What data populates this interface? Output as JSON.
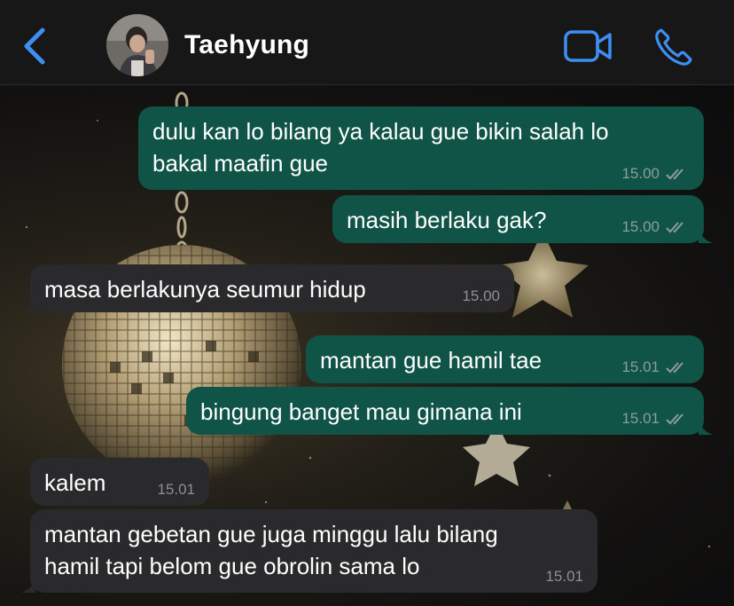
{
  "header": {
    "back_icon": "chevron-left-icon",
    "contact_name": "Taehyung",
    "video_icon": "video-camera-icon",
    "call_icon": "phone-icon",
    "accent_color": "#3d8ff3"
  },
  "colors": {
    "outgoing_bubble": "#0f5447",
    "incoming_bubble": "#2a2a2c",
    "timestamp": "#8c9e9a"
  },
  "messages": [
    {
      "direction": "out",
      "text": "dulu kan lo bilang ya kalau gue bikin salah lo\nbakal maafin gue",
      "time": "15.00",
      "status_icon": "double-check-icon"
    },
    {
      "direction": "out",
      "text": "masih berlaku gak?",
      "time": "15.00",
      "status_icon": "double-check-icon"
    },
    {
      "direction": "in",
      "text": "masa berlakunya seumur hidup",
      "time": "15.00"
    },
    {
      "direction": "out",
      "text": "mantan gue hamil tae",
      "time": "15.01",
      "status_icon": "double-check-icon"
    },
    {
      "direction": "out",
      "text": "bingung banget mau gimana ini",
      "time": "15.01",
      "status_icon": "double-check-icon"
    },
    {
      "direction": "in",
      "text": "kalem",
      "time": "15.01"
    },
    {
      "direction": "in",
      "text": "mantan gebetan gue juga minggu lalu bilang\nhamil tapi belom gue obrolin sama lo",
      "time": "15.01"
    }
  ]
}
